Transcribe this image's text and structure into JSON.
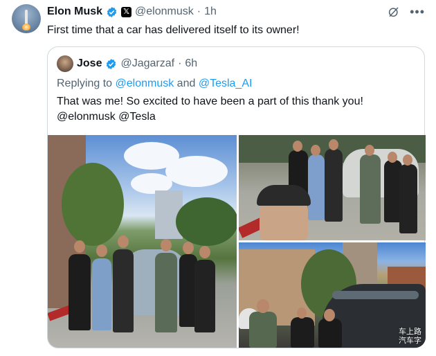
{
  "tweet": {
    "author_name": "Elon Musk",
    "author_handle": "@elonmusk",
    "separator": "·",
    "time": "1h",
    "text": "First time that a car has delivered itself to its owner!"
  },
  "quoted_tweet": {
    "author_name": "Jose",
    "author_handle": "@Jagarzaf",
    "separator": "·",
    "time": "6h",
    "replying_prefix": "Replying to",
    "replying_user1": "@elonmusk",
    "replying_and": "and",
    "replying_user2": "@Tesla_AI",
    "text_line1": "That was me! So excited to have been a part of this thank you!",
    "mention1": "@elonmusk",
    "mention2": "@Tesla"
  },
  "photos": [
    "photo-group-car",
    "photo-group-selfie",
    "photo-trunk-open"
  ],
  "watermark": {
    "line1": "车上路",
    "line2": "汽车字"
  },
  "colors": {
    "link": "#1d9bf0",
    "secondary_text": "#536471",
    "verified": "#1d9bf0",
    "border": "#cfd9de"
  }
}
